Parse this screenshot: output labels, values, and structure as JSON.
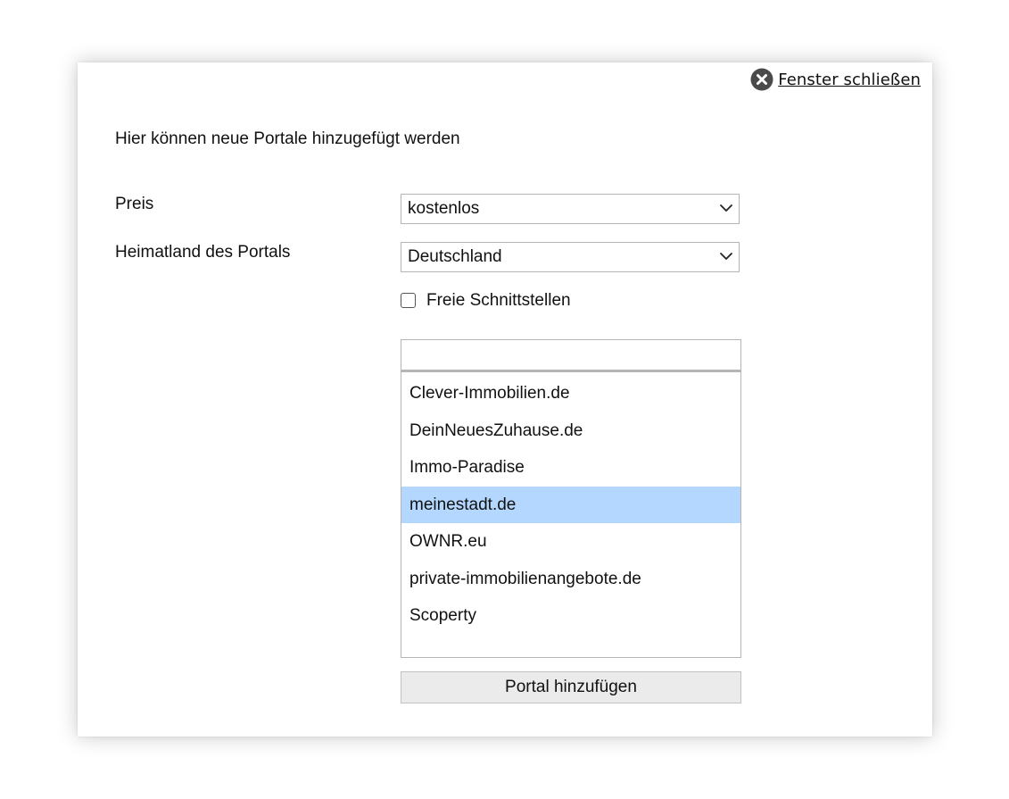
{
  "dialog": {
    "close_label": "Fenster schließen",
    "close_icon": "close-circle-icon",
    "intro": "Hier können neue Portale hinzugefügt werden"
  },
  "form": {
    "price_label": "Preis",
    "price_value": "kostenlos",
    "country_label": "Heimatland des Portals",
    "country_value": "Deutschland",
    "free_interfaces_label": "Freie Schnittstellen",
    "free_interfaces_checked": false,
    "filter_value": ""
  },
  "portals": {
    "items": [
      "Clever-Immobilien.de",
      "DeinNeuesZuhause.de",
      "Immo-Paradise",
      "meinestadt.de",
      "OWNR.eu",
      "private-immobilienangebote.de",
      "Scoperty"
    ],
    "selected_index": 3
  },
  "actions": {
    "add_label": "Portal hinzufügen"
  },
  "colors": {
    "selection": "#b3d7ff",
    "button_bg": "#ebebeb",
    "border": "#b5b5b5"
  }
}
